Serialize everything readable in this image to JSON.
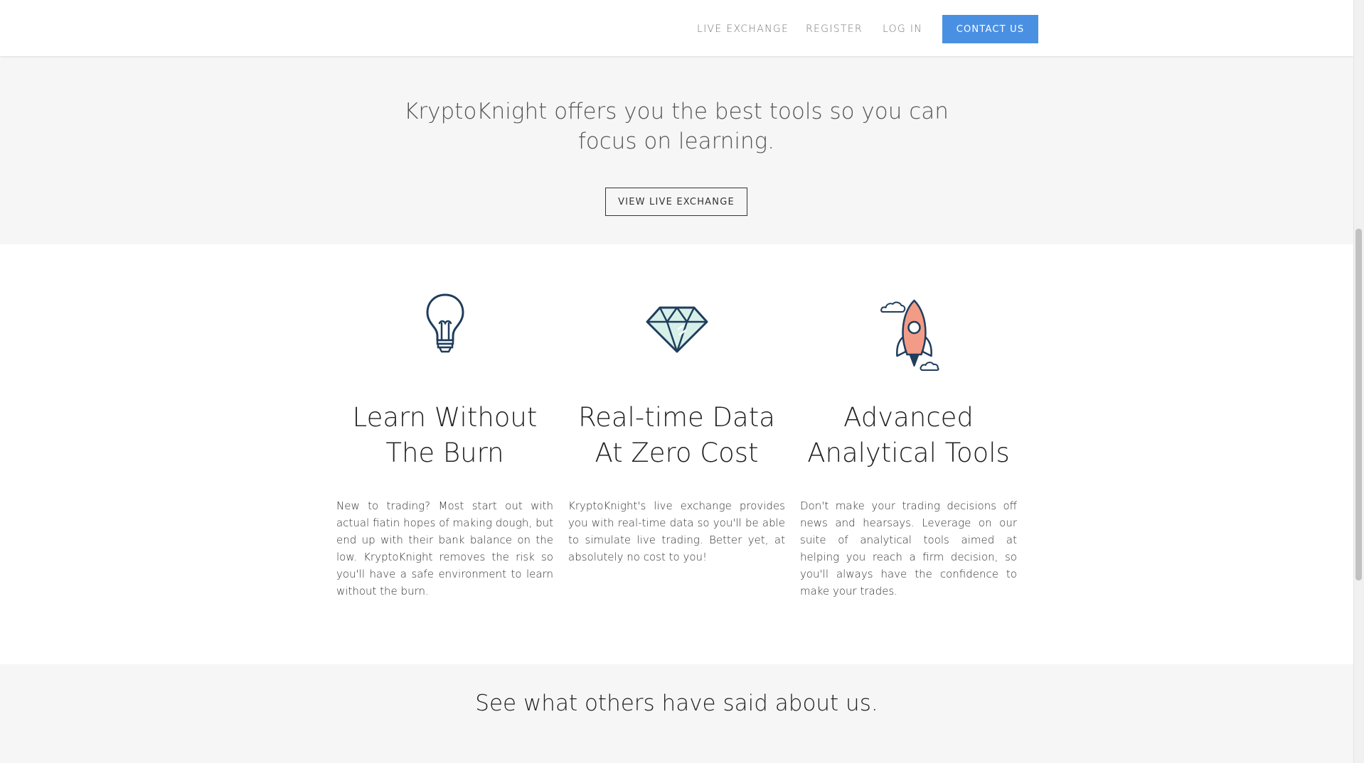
{
  "nav": {
    "live_exchange": "LIVE EXCHANGE",
    "register": "REGISTER",
    "login": "LOG IN",
    "contact": "CONTACT US"
  },
  "hero": {
    "heading_line1": "KryptoKnight offers you the best tools so you can",
    "heading_line2": "focus on learning.",
    "button": "VIEW LIVE EXCHANGE"
  },
  "features": [
    {
      "icon": "lightbulb-icon",
      "title_line1": "Learn Without",
      "title_line2": "The Burn",
      "text": "New to trading? Most start out with actual fiatin hopes of making dough, but end up with their bank balance on the low. KryptoKnight removes the risk so you'll have a safe environment to learn without the burn."
    },
    {
      "icon": "diamond-icon",
      "title_line1": "Real-time Data",
      "title_line2": "At Zero Cost",
      "text": "KryptoKnight's live exchange provides you with real-time data so you'll be able to simulate live trading. Better yet, at absolutely no cost to you!"
    },
    {
      "icon": "rocket-icon",
      "title_line1": "Advanced",
      "title_line2": "Analytical Tools",
      "text": "Don't make your trading decisions off news and hearsays. Leverage on our suite of analytical tools aimed at helping you reach a firm decision, so you'll always have the confidence to make your trades."
    }
  ],
  "testimonials": {
    "heading": "See what others have said about us."
  },
  "colors": {
    "accent": "#4a90e2",
    "section_bg": "#f6f6f6",
    "icon_stroke": "#1f3d5c",
    "diamond_fill": "#d6efe9",
    "rocket_fill": "#f29b86"
  }
}
